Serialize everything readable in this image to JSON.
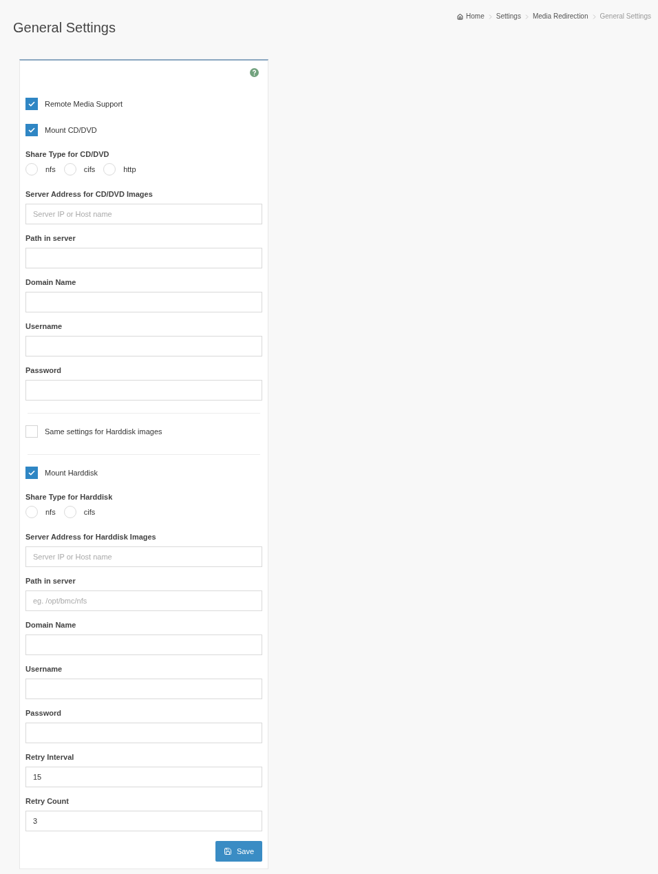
{
  "page": {
    "title": "General Settings"
  },
  "breadcrumb": [
    {
      "label": "Home",
      "current": false
    },
    {
      "label": "Settings",
      "current": false
    },
    {
      "label": "Media Redirection",
      "current": false
    },
    {
      "label": "General Settings",
      "current": true
    }
  ],
  "form": {
    "items": [
      {
        "kind": "checkbox",
        "label": "Remote Media Support",
        "checked": true
      },
      {
        "kind": "checkbox",
        "label": "Mount CD/DVD",
        "checked": true
      },
      {
        "kind": "radio_group",
        "label": "Share Type for CD/DVD",
        "options": [
          {
            "label": "nfs",
            "selected": false
          },
          {
            "label": "cifs",
            "selected": false
          },
          {
            "label": "http",
            "selected": false
          }
        ]
      },
      {
        "kind": "input",
        "label": "Server Address for CD/DVD Images",
        "placeholder": "Server IP or Host name"
      },
      {
        "kind": "input",
        "label": "Path in server"
      },
      {
        "kind": "input",
        "label": "Domain Name"
      },
      {
        "kind": "input",
        "label": "Username"
      },
      {
        "kind": "input",
        "label": "Password"
      },
      {
        "kind": "divider"
      },
      {
        "kind": "checkbox",
        "label": "Same settings for Harddisk images",
        "checked": false
      },
      {
        "kind": "divider"
      },
      {
        "kind": "checkbox",
        "label": "Mount Harddisk",
        "checked": true
      },
      {
        "kind": "radio_group",
        "label": "Share Type for Harddisk",
        "options": [
          {
            "label": "nfs",
            "selected": false
          },
          {
            "label": "cifs",
            "selected": false
          }
        ]
      },
      {
        "kind": "input",
        "label": "Server Address for Harddisk Images",
        "placeholder": "Server IP or Host name"
      },
      {
        "kind": "input",
        "label": "Path in server",
        "placeholder": "eg. /opt/bmc/nfs"
      },
      {
        "kind": "input",
        "label": "Domain Name"
      },
      {
        "kind": "input",
        "label": "Username"
      },
      {
        "kind": "input",
        "label": "Password"
      },
      {
        "kind": "input",
        "label": "Retry Interval",
        "value": "15"
      },
      {
        "kind": "input",
        "label": "Retry Count",
        "value": "3"
      }
    ],
    "save_button": {
      "label": "Save"
    }
  }
}
